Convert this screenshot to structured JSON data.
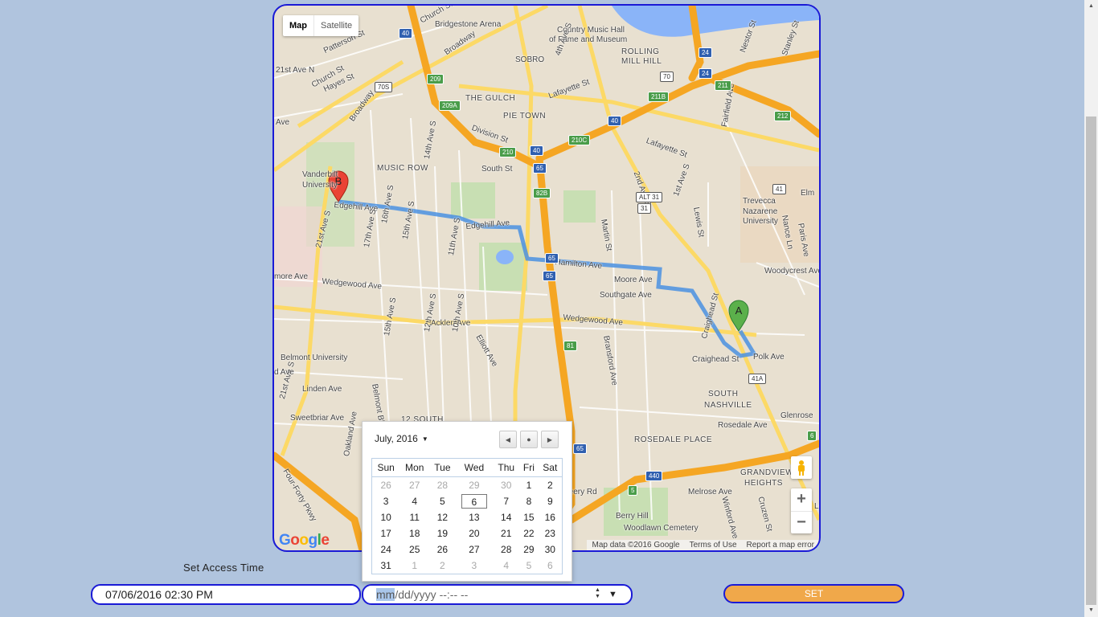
{
  "map": {
    "type_buttons": [
      "Map",
      "Satellite"
    ],
    "google_logo": "Google",
    "attribution": [
      "Map data ©2016 Google",
      "Terms of Use",
      "Report a map error"
    ],
    "zoom_in": "+",
    "zoom_out": "−",
    "marker_a": "A",
    "marker_b": "B",
    "labels": [
      "Bridgestone Arena",
      "Country Music Hall",
      "of Fame and Museum",
      "SOBRO",
      "ROLLING",
      "MILL HILL",
      "THE GULCH",
      "PIE TOWN",
      "Lafayette St",
      "Lafayette St",
      "Division St",
      "Church St",
      "Church St",
      "Broadway",
      "Broadway",
      "Patterson St",
      "Hayes St",
      "MUSIC ROW",
      "South St",
      "Vanderbilt",
      "University",
      "Edgehill Ave",
      "Edgehill Ave",
      "Hamilton Ave",
      "Moore Ave",
      "Southgate Ave",
      "Wedgewood Ave",
      "Wedgewood Ave",
      "Acklen Ave",
      "Belmont University",
      "Linden Ave",
      "Sweetbriar Ave",
      "12 SOUTH",
      "Craighead St",
      "Polk Ave",
      "SOUTH",
      "NASHVILLE",
      "ROSEDALE PLACE",
      "Rosedale Ave",
      "Glenrose",
      "GRANDVIEW",
      "HEIGHTS",
      "Melrose Ave",
      "Berry Hill",
      "Woodlawn Cemetery",
      "Trevecca",
      "Nazarene",
      "University",
      "Woodycrest Ave",
      "Nestor St",
      "Stanley St",
      "Fairfield Ave",
      "Nance Ln",
      "Paris Ave",
      "Lewis St",
      "1st Ave S",
      "2nd Ave S",
      "Martin St",
      "Bransford Ave",
      "21st Ave S",
      "21st Ave S",
      "17th Ave S",
      "16th Ave S",
      "15th Ave S",
      "14th Ave S",
      "11th Ave S",
      "12th Ave S",
      "10th Ave S",
      "15th Ave S",
      "Belmont Blvd",
      "Elliott Ave",
      "Four-Forty Pkwy",
      "Oakland Ave",
      "Wharf Ave",
      "Winford Ave",
      "Cruzen St",
      "Beery Rd",
      "Craighead St",
      "4th Ave S",
      "Elm",
      "more Ave",
      "d Ave",
      "Le",
      "21st Ave N",
      "Ave"
    ],
    "shields": [
      "40",
      "70S",
      "209",
      "209A",
      "40",
      "24",
      "24",
      "211",
      "211B",
      "212",
      "70",
      "210",
      "40",
      "65",
      "210C",
      "82B",
      "31",
      "41",
      "ALT 31",
      "65",
      "65",
      "81",
      "41A",
      "65",
      "440",
      "5",
      "6"
    ]
  },
  "calendar": {
    "month_label": "July, 2016",
    "weekdays": [
      "Sun",
      "Mon",
      "Tue",
      "Wed",
      "Thu",
      "Fri",
      "Sat"
    ],
    "weeks": [
      [
        "26",
        "27",
        "28",
        "29",
        "30",
        "1",
        "2"
      ],
      [
        "3",
        "4",
        "5",
        "6",
        "7",
        "8",
        "9"
      ],
      [
        "10",
        "11",
        "12",
        "13",
        "14",
        "15",
        "16"
      ],
      [
        "17",
        "18",
        "19",
        "20",
        "21",
        "22",
        "23"
      ],
      [
        "24",
        "25",
        "26",
        "27",
        "28",
        "29",
        "30"
      ],
      [
        "31",
        "1",
        "2",
        "3",
        "4",
        "5",
        "6"
      ]
    ],
    "today": "6"
  },
  "form": {
    "label": "Set Access Time",
    "field1_value": "07/06/2016 02:30 PM",
    "field2_highlight": "mm",
    "field2_placeholder": "/dd/yyyy --:-- --",
    "set_button": "SET"
  }
}
